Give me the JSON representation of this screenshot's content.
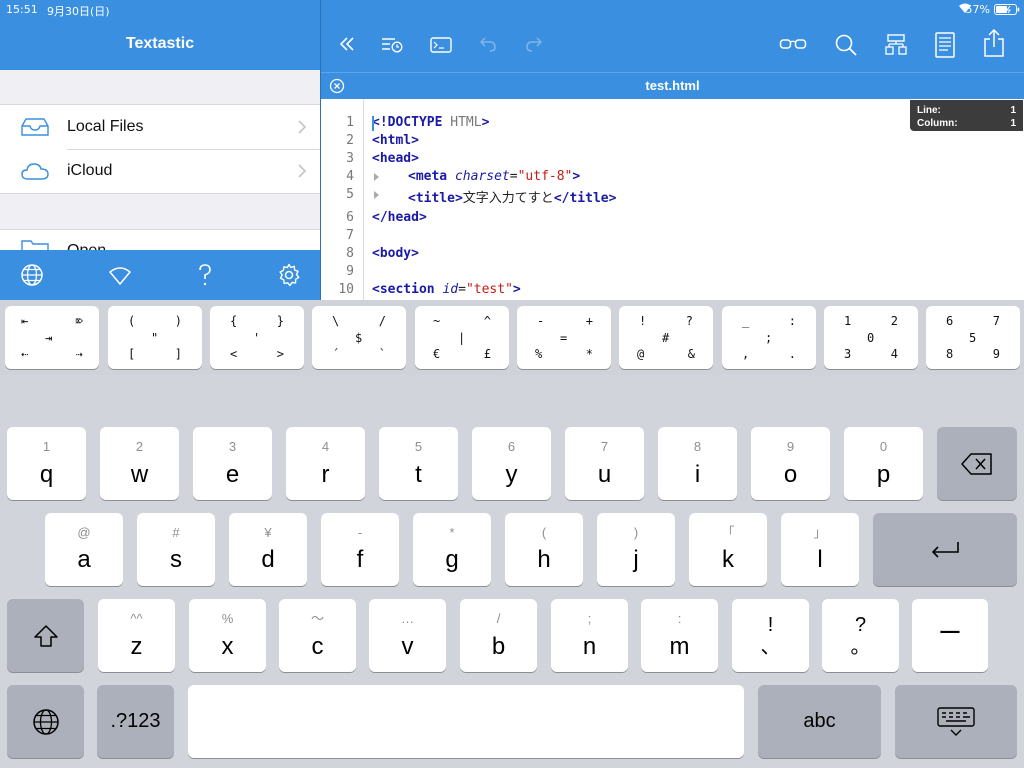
{
  "status": {
    "time": "15:51",
    "date": "9月30日(日)",
    "battery": "57%"
  },
  "sidebar": {
    "title": "Textastic",
    "items": [
      {
        "label": "Local Files"
      },
      {
        "label": "iCloud"
      }
    ],
    "open_label": "Open..."
  },
  "editor": {
    "tab_title": "test.html",
    "line_col": {
      "line_label": "Line:",
      "line_value": "1",
      "column_label": "Column:",
      "column_value": "1"
    },
    "line_numbers": [
      "1",
      "2",
      "3",
      "4",
      "5",
      "6",
      "7",
      "8",
      "9",
      "10"
    ],
    "code": {
      "l1_open": "<!DOCTYPE",
      "l1_rest": " HTML",
      "l1_close": ">",
      "l2": "<html>",
      "l3": "<head>",
      "l4_open": "<meta",
      "l4_attr": " charset",
      "l4_eq": "=",
      "l4_val": "\"utf-8\"",
      "l4_close": ">",
      "l5_open": "<title>",
      "l5_text": "文字入力てすと",
      "l5_close": "</title>",
      "l6": "</head>",
      "l8": "<body>",
      "l10_open": "<section",
      "l10_attr": " id",
      "l10_eq": "=",
      "l10_val": "\"test\"",
      "l10_close": ">"
    }
  },
  "extra_keys": [
    {
      "tl": "⇤",
      "tr": "⌦",
      "mid": "⇥",
      "bl": "⇠",
      "br": "⇢"
    },
    {
      "tl": "(",
      "tr": ")",
      "mid": "\"",
      "bl": "[",
      "br": "]"
    },
    {
      "tl": "{",
      "tr": "}",
      "mid": "'",
      "bl": "<",
      "br": ">"
    },
    {
      "tl": "\\",
      "tr": "/",
      "mid": "$",
      "bl": "´",
      "br": "`"
    },
    {
      "tl": "~",
      "tr": "^",
      "mid": "|",
      "bl": "€",
      "br": "£"
    },
    {
      "tl": "-",
      "tr": "+",
      "mid": "=",
      "bl": "%",
      "br": "*"
    },
    {
      "tl": "!",
      "tr": "?",
      "mid": "#",
      "bl": "@",
      "br": "&"
    },
    {
      "tl": "_",
      "tr": ":",
      "mid": ";",
      "bl": ",",
      "br": "."
    },
    {
      "tl": "1",
      "tr": "2",
      "mid": "0",
      "bl": "3",
      "br": "4"
    },
    {
      "tl": "6",
      "tr": "7",
      "mid": "5",
      "bl": "8",
      "br": "9"
    }
  ],
  "keyboard": {
    "row1": [
      {
        "main": "q",
        "sub": "1"
      },
      {
        "main": "w",
        "sub": "2"
      },
      {
        "main": "e",
        "sub": "3"
      },
      {
        "main": "r",
        "sub": "4"
      },
      {
        "main": "t",
        "sub": "5"
      },
      {
        "main": "y",
        "sub": "6"
      },
      {
        "main": "u",
        "sub": "7"
      },
      {
        "main": "i",
        "sub": "8"
      },
      {
        "main": "o",
        "sub": "9"
      },
      {
        "main": "p",
        "sub": "0"
      }
    ],
    "row2": [
      {
        "main": "a",
        "sub": "@"
      },
      {
        "main": "s",
        "sub": "#"
      },
      {
        "main": "d",
        "sub": "¥"
      },
      {
        "main": "f",
        "sub": "-"
      },
      {
        "main": "g",
        "sub": "*"
      },
      {
        "main": "h",
        "sub": "("
      },
      {
        "main": "j",
        "sub": ")"
      },
      {
        "main": "k",
        "sub": "「"
      },
      {
        "main": "l",
        "sub": "」"
      }
    ],
    "row3": [
      {
        "main": "z",
        "sub": "^^"
      },
      {
        "main": "x",
        "sub": "%"
      },
      {
        "main": "c",
        "sub": "〜"
      },
      {
        "main": "v",
        "sub": "…"
      },
      {
        "main": "b",
        "sub": "/"
      },
      {
        "main": "n",
        "sub": ";"
      },
      {
        "main": "m",
        "sub": ":"
      }
    ],
    "punct1": {
      "top": "!",
      "bottom": "、"
    },
    "punct2": {
      "top": "?",
      "bottom": "。"
    },
    "dash": "ー",
    "numbers_label": ".?123",
    "abc_label": "abc"
  }
}
